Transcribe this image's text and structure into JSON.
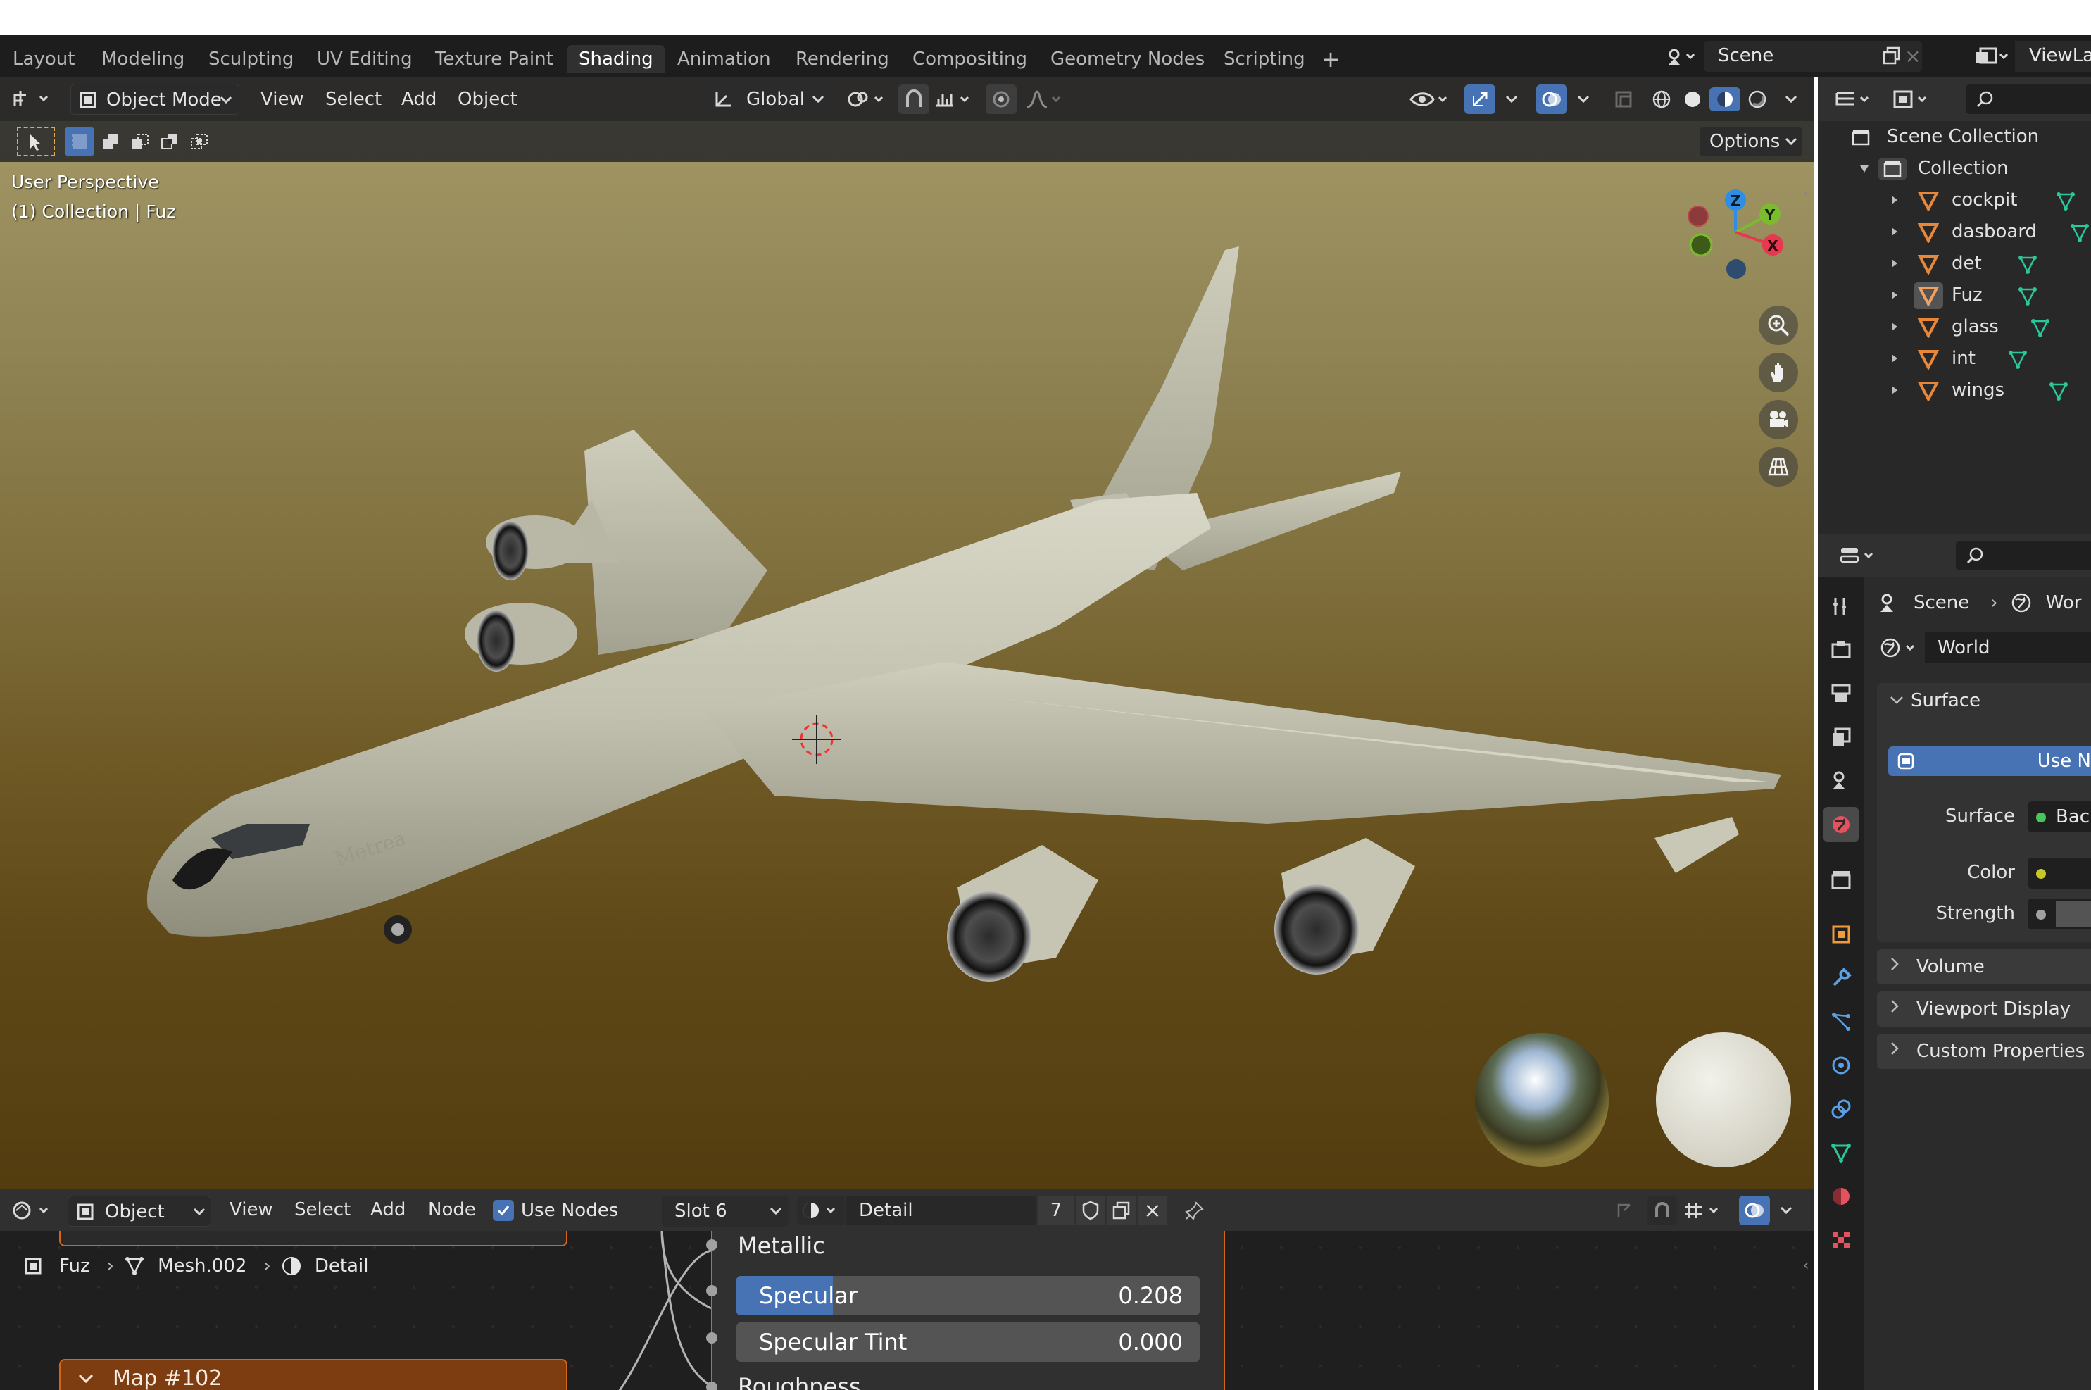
{
  "workspace_tabs": [
    "Layout",
    "Modeling",
    "Sculpting",
    "UV Editing",
    "Texture Paint",
    "Shading",
    "Animation",
    "Rendering",
    "Compositing",
    "Geometry Nodes",
    "Scripting"
  ],
  "active_tab": "Shading",
  "add_workspace_icon": "plus-icon",
  "scene_name": "Scene",
  "view_layer_label": "ViewLa",
  "viewport": {
    "mode": "Object Mode",
    "menus": [
      "View",
      "Select",
      "Add",
      "Object"
    ],
    "transform_orientation": "Global",
    "options_label": "Options",
    "overlay_line1": "User Perspective",
    "overlay_line2": "(1) Collection | Fuz",
    "gizmo_axes": {
      "z": "Z",
      "y": "Y",
      "x": "X"
    },
    "colors": {
      "x_axis": "#e8384f",
      "y_axis": "#7dbb2e",
      "z_axis": "#2f8de4"
    },
    "nav_icons": [
      "zoom-icon",
      "hand-pan-icon",
      "camera-icon",
      "grid-ortho-icon"
    ],
    "aircraft_text": "Metrea"
  },
  "node_editor": {
    "editor_type": "Object",
    "menus": [
      "View",
      "Select",
      "Add",
      "Node"
    ],
    "use_nodes_label": "Use Nodes",
    "use_nodes_checked": true,
    "slot": "Slot 6",
    "material_name": "Detail",
    "user_count": "7",
    "breadcrumb": [
      "Fuz",
      "Mesh.002",
      "Detail"
    ],
    "map_node_title": "Map #102",
    "sockets": {
      "metallic": "Metallic",
      "specular_label": "Specular",
      "specular_value": "0.208",
      "specular_fraction": 0.208,
      "specular_tint_label": "Specular Tint",
      "specular_tint_value": "0.000",
      "roughness": "Roughness"
    }
  },
  "outliner": {
    "scene_collection": "Scene Collection",
    "collection": "Collection",
    "items": [
      "cockpit",
      "dasboard",
      "det",
      "Fuz",
      "glass",
      "int",
      "wings"
    ],
    "selected": "Fuz"
  },
  "properties": {
    "breadcrumb_scene": "Scene",
    "breadcrumb_world": "Wor",
    "world_name": "World",
    "surface_panel": "Surface",
    "use_nodes_button": "Use N",
    "surface_label": "Surface",
    "surface_value": "Bac",
    "color_label": "Color",
    "strength_label": "Strength",
    "collapsed_panels": [
      "Volume",
      "Viewport Display",
      "Custom Properties"
    ],
    "accent": "#4772b3"
  }
}
